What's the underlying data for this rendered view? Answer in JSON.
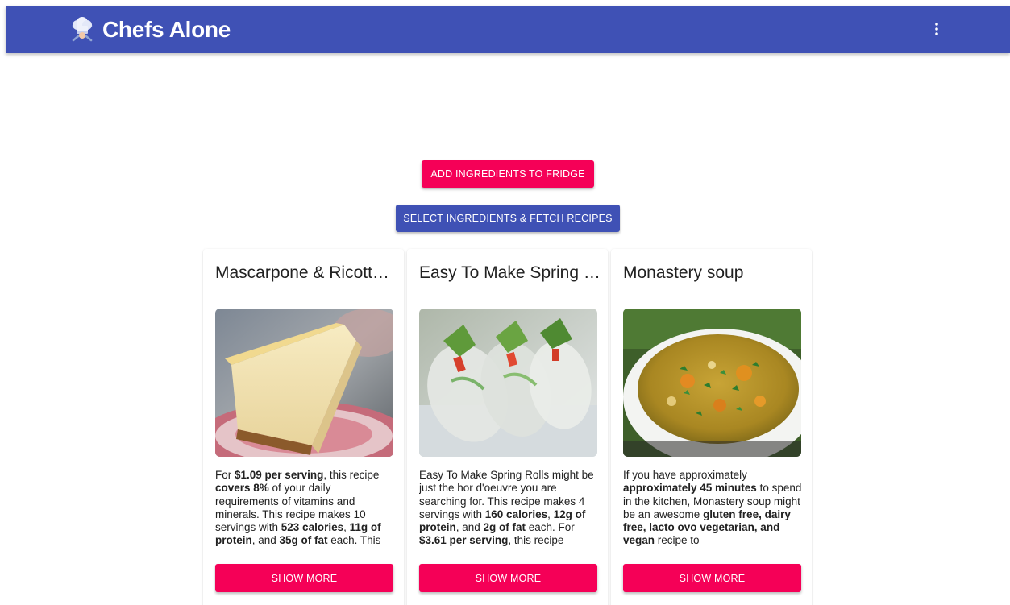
{
  "colors": {
    "primary": "#3f51b5",
    "accent": "#f50057",
    "text": "#212121"
  },
  "header": {
    "title": "Chefs Alone",
    "logo_icon": "chef-hat-icon",
    "menu_icon": "more-vert-icon"
  },
  "actions": {
    "add_label": "Add ingredients to fridge",
    "fetch_label": "Select ingredients & fetch recipes"
  },
  "recipes": [
    {
      "title": "Mascarpone & Ricotta Cheesecake",
      "image_icon": "cheesecake-image",
      "description": [
        {
          "t": "For ",
          "b": false
        },
        {
          "t": "$1.09 per serving",
          "b": true
        },
        {
          "t": ", this recipe ",
          "b": false
        },
        {
          "t": "covers 8%",
          "b": true
        },
        {
          "t": " of your daily requirements of vitamins and minerals. This recipe makes 10 servings with ",
          "b": false
        },
        {
          "t": "523 calories",
          "b": true
        },
        {
          "t": ", ",
          "b": false
        },
        {
          "t": "11g of protein",
          "b": true
        },
        {
          "t": ", and ",
          "b": false
        },
        {
          "t": "35g of fat",
          "b": true
        },
        {
          "t": " each. This",
          "b": false
        }
      ],
      "button_label": "Show more"
    },
    {
      "title": "Easy To Make Spring Rolls",
      "image_icon": "spring-rolls-image",
      "description": [
        {
          "t": "Easy To Make Spring Rolls might be just the hor d'oeuvre you are searching for. This recipe makes 4 servings with ",
          "b": false
        },
        {
          "t": "160 calories",
          "b": true
        },
        {
          "t": ", ",
          "b": false
        },
        {
          "t": "12g of protein",
          "b": true
        },
        {
          "t": ", and ",
          "b": false
        },
        {
          "t": "2g of fat",
          "b": true
        },
        {
          "t": " each. For ",
          "b": false
        },
        {
          "t": "$3.61 per serving",
          "b": true
        },
        {
          "t": ", this recipe",
          "b": false
        }
      ],
      "button_label": "Show more"
    },
    {
      "title": "Monastery soup",
      "image_icon": "soup-image",
      "description": [
        {
          "t": "If you have approximately ",
          "b": false
        },
        {
          "t": "approximately 45 minutes",
          "b": true
        },
        {
          "t": " to spend in the kitchen, Monastery soup might be an awesome ",
          "b": false
        },
        {
          "t": "gluten free, dairy free, lacto ovo vegetarian, and vegan",
          "b": true
        },
        {
          "t": " recipe to",
          "b": false
        }
      ],
      "button_label": "Show more"
    }
  ]
}
